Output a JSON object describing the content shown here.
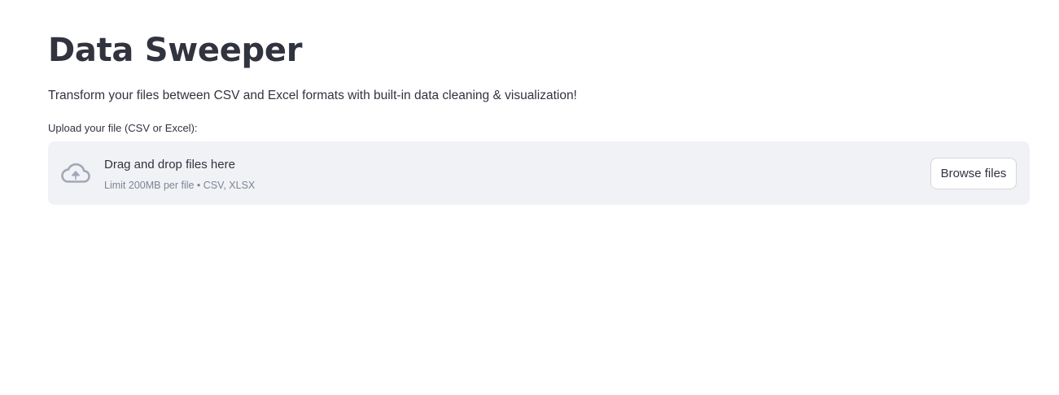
{
  "page": {
    "title": "Data Sweeper",
    "subtitle": "Transform your files between CSV and Excel formats with built-in data cleaning & visualization!"
  },
  "uploader": {
    "label": "Upload your file (CSV or Excel):",
    "dropzone_title": "Drag and drop files here",
    "dropzone_hint": "Limit 200MB per file • CSV, XLSX",
    "browse_label": "Browse files",
    "icon": "cloud-upload-icon"
  },
  "colors": {
    "text": "#31333f",
    "muted_text": "#808495",
    "dropzone_bg": "#f0f2f6",
    "icon": "#a3a8b8",
    "button_border": "#d6d6d9"
  }
}
